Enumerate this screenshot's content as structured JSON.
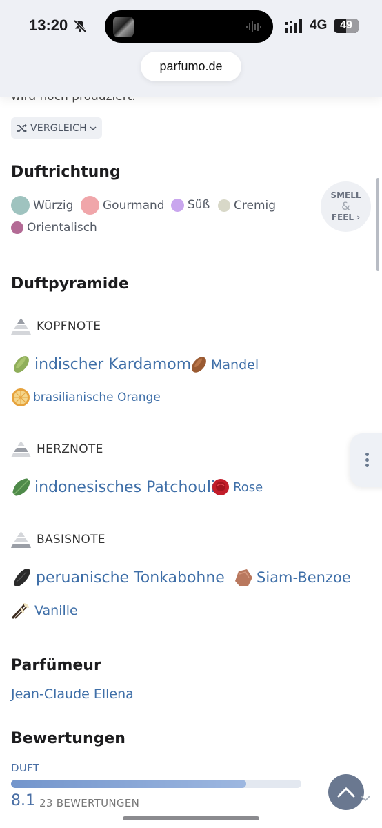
{
  "status_bar": {
    "time": "13:20",
    "network": "4G",
    "battery": "49",
    "battery_level": 0.49,
    "icons": [
      "bell-slash-icon",
      "waveform-icon",
      "cellular-signal-icon"
    ]
  },
  "browser": {
    "url": "parfumo.de"
  },
  "page": {
    "cut_text": "wird noch produziert.",
    "compare_label": "VERGLEICH",
    "duftrichtung": {
      "title": "Duftrichtung",
      "accords": [
        {
          "label": "Würzig",
          "color": "#9fc3bf"
        },
        {
          "label": "Gourmand",
          "color": "#f0a6aa"
        },
        {
          "label": "Süß",
          "color": "#c9a6ee"
        },
        {
          "label": "Cremig",
          "color": "#d8d8c8"
        },
        {
          "label": "Orientalisch",
          "color": "#b36a95"
        }
      ],
      "smell_feel": {
        "line1": "SMELL",
        "amp": "&",
        "line2": "FEEL ›"
      }
    },
    "duftpyramide": {
      "title": "Duftpyramide",
      "kopf": {
        "label": "KOPFNOTE",
        "notes": [
          "indischer Kardamom",
          "Mandel",
          "brasilianische Orange"
        ]
      },
      "herz": {
        "label": "HERZNOTE",
        "notes": [
          "indonesisches Patchouli",
          "Rose"
        ]
      },
      "basis": {
        "label": "BASISNOTE",
        "notes": [
          "peruanische Tonkabohne",
          "Siam-Benzoe",
          "Vanille"
        ]
      }
    },
    "parfuemeur": {
      "title": "Parfümeur",
      "name": "Jean-Claude Ellena"
    },
    "bewertungen": {
      "title": "Bewertungen",
      "category": "DUFT",
      "score": "8.1",
      "score_fraction": 0.81,
      "count": "23 BEWERTUNGEN"
    }
  },
  "colors": {
    "link": "#3f6fa8",
    "accent_button": "#6a7890"
  }
}
